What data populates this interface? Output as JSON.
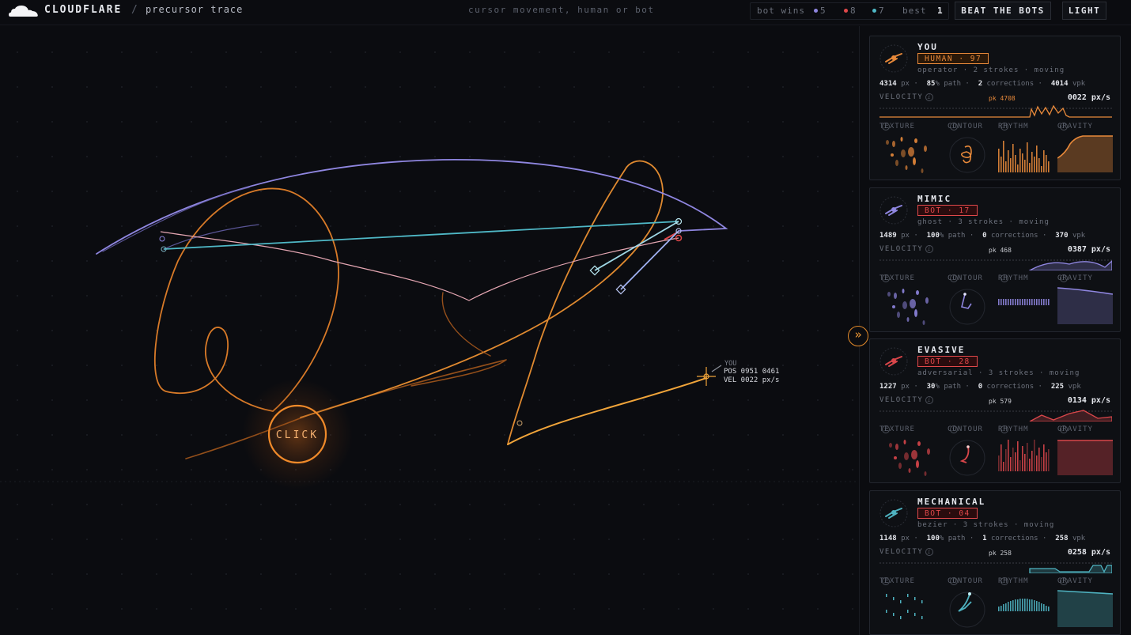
{
  "header": {
    "brand": "CLOUDFLARE",
    "separator": "/",
    "subtitle": "precursor trace",
    "tagline": "cursor movement, human or bot",
    "bot_wins_label": "bot wins",
    "wins": [
      {
        "count": "5",
        "color": "#8f86e0"
      },
      {
        "count": "8",
        "color": "#e0484a"
      },
      {
        "count": "7",
        "color": "#4fb8c6"
      }
    ],
    "best_label": "best",
    "best_value": "1",
    "beat_button": "BEAT THE BOTS",
    "theme_button": "LIGHT"
  },
  "canvas": {
    "click_label": "CLICK",
    "readout": {
      "label": "YOU",
      "pos": "POS 0951 0461",
      "vel": "VEL 0022 px/s"
    }
  },
  "panel": {
    "collapse_glyph": "»",
    "section_labels": {
      "velocity": "VELOCITY",
      "texture": "TEXTURE",
      "contour": "CONTOUR",
      "rhythm": "RHYTHM",
      "gravity": "GRAVITY"
    },
    "units": {
      "px": "px",
      "path": "% path",
      "corrections": "corrections",
      "vpk": "vpk"
    },
    "cards": [
      {
        "name": "YOU",
        "badge": "HUMAN · 97",
        "kind": "human",
        "accent": "#e8893a",
        "desc": "operator · 2 strokes · moving",
        "px": "4314",
        "path": "85",
        "corrections": "2",
        "vpk": "4014",
        "pk": "pk 4708",
        "velocity": "0022 px/s"
      },
      {
        "name": "MIMIC",
        "badge": "BOT · 17",
        "kind": "bot",
        "accent": "#8f86e0",
        "desc": "ghost · 3 strokes · moving",
        "px": "1489",
        "path": "100",
        "corrections": "0",
        "vpk": "370",
        "pk": "pk 468",
        "velocity": "0387 px/s"
      },
      {
        "name": "EVASIVE",
        "badge": "BOT · 28",
        "kind": "bot",
        "accent": "#d9464a",
        "desc": "adversarial · 3 strokes · moving",
        "px": "1227",
        "path": "30",
        "corrections": "0",
        "vpk": "225",
        "pk": "pk 579",
        "velocity": "0134 px/s"
      },
      {
        "name": "MECHANICAL",
        "badge": "BOT · 04",
        "kind": "bot",
        "accent": "#4fb3c1",
        "desc": "bezier · 3 strokes · moving",
        "px": "1148",
        "path": "100",
        "corrections": "1",
        "vpk": "258",
        "pk": "pk 258",
        "velocity": "0258 px/s"
      }
    ]
  }
}
